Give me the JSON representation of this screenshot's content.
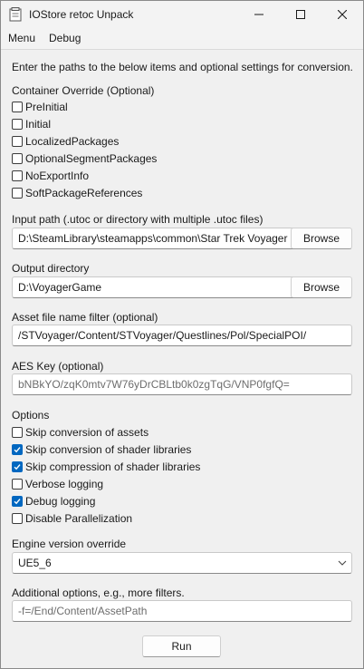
{
  "window": {
    "title": "IOStore retoc Unpack",
    "icon": "app-icon"
  },
  "menubar": {
    "items": [
      "Menu",
      "Debug"
    ]
  },
  "intro_text": "Enter the paths to the below items and optional settings for conversion.",
  "container_override": {
    "heading": "Container Override (Optional)",
    "options": [
      {
        "label": "PreInitial",
        "checked": false
      },
      {
        "label": "Initial",
        "checked": false
      },
      {
        "label": "LocalizedPackages",
        "checked": false
      },
      {
        "label": "OptionalSegmentPackages",
        "checked": false
      },
      {
        "label": "NoExportInfo",
        "checked": false
      },
      {
        "label": "SoftPackageReferences",
        "checked": false
      }
    ]
  },
  "input_path": {
    "label": "Input path (.utoc or directory with multiple .utoc files)",
    "value": "D:\\SteamLibrary\\steamapps\\common\\Star Trek Voyager - ",
    "browse_label": "Browse"
  },
  "output_dir": {
    "label": "Output directory",
    "value": "D:\\VoyagerGame",
    "browse_label": "Browse"
  },
  "asset_filter": {
    "label": "Asset file name filter (optional)",
    "value": "/STVoyager/Content/STVoyager/Questlines/Pol/SpecialPOI/"
  },
  "aes_key": {
    "label": "AES Key (optional)",
    "placeholder": "bNBkYO/zqK0mtv7W76yDrCBLtb0k0zgTqG/VNP0fgfQ="
  },
  "options": {
    "heading": "Options",
    "items": [
      {
        "label": "Skip conversion of assets",
        "checked": false
      },
      {
        "label": "Skip conversion of shader libraries",
        "checked": true
      },
      {
        "label": "Skip compression of shader libraries",
        "checked": true
      },
      {
        "label": "Verbose logging",
        "checked": false
      },
      {
        "label": "Debug logging",
        "checked": true
      },
      {
        "label": "Disable Parallelization",
        "checked": false
      }
    ]
  },
  "engine_version": {
    "label": "Engine version override",
    "selected": "UE5_6"
  },
  "additional": {
    "label": "Additional options, e.g., more filters.",
    "placeholder": "-f=/End/Content/AssetPath"
  },
  "run_label": "Run",
  "colors": {
    "accent": "#0067c0",
    "window_bg": "#f0f0f0"
  }
}
